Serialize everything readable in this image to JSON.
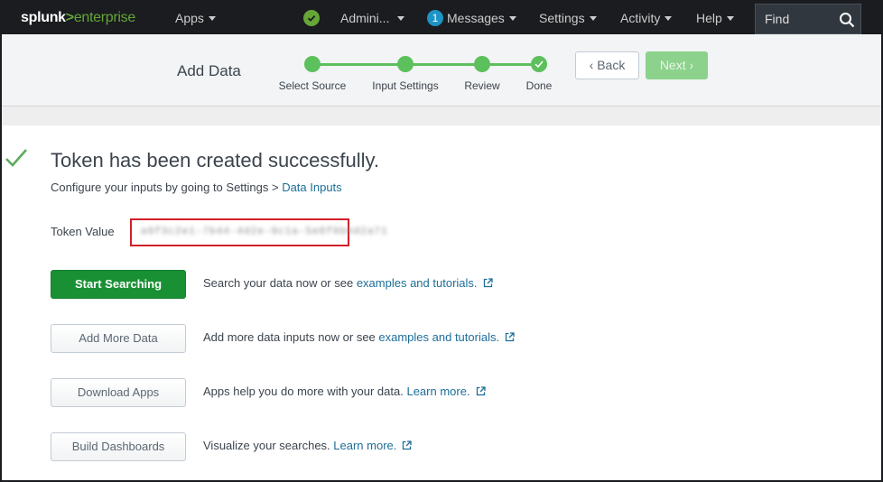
{
  "brand": {
    "bold": "splunk",
    "gt": ">",
    "rest": "enterprise"
  },
  "nav": {
    "apps": "Apps",
    "admin": "Admini...",
    "messages_count": "1",
    "messages": "Messages",
    "settings": "Settings",
    "activity": "Activity",
    "help": "Help",
    "find_placeholder": "Find"
  },
  "wizard": {
    "title": "Add Data",
    "steps": [
      "Select Source",
      "Input Settings",
      "Review",
      "Done"
    ],
    "back_label": "Back",
    "next_label": "Next"
  },
  "result": {
    "headline": "Token has been created successfully.",
    "sub_prefix": "Configure your inputs by going to Settings > ",
    "sub_link": "Data Inputs",
    "token_label": "Token Value",
    "token_value": "a9f3c2e1-7b44-4d2e-9c1a-5e8f0b6d2a71"
  },
  "actions": [
    {
      "button": "Start Searching",
      "desc": "Search your data now or see ",
      "link": "examples and tutorials."
    },
    {
      "button": "Add More Data",
      "desc": "Add more data inputs now or see ",
      "link": "examples and tutorials."
    },
    {
      "button": "Download Apps",
      "desc": "Apps help you do more with your data. ",
      "link": "Learn more."
    },
    {
      "button": "Build Dashboards",
      "desc": "Visualize your searches. ",
      "link": "Learn more."
    }
  ],
  "colors": {
    "accent_green": "#65a637",
    "primary_button": "#1a9035",
    "link": "#1e6e98",
    "highlight_border": "#d21f2a"
  }
}
